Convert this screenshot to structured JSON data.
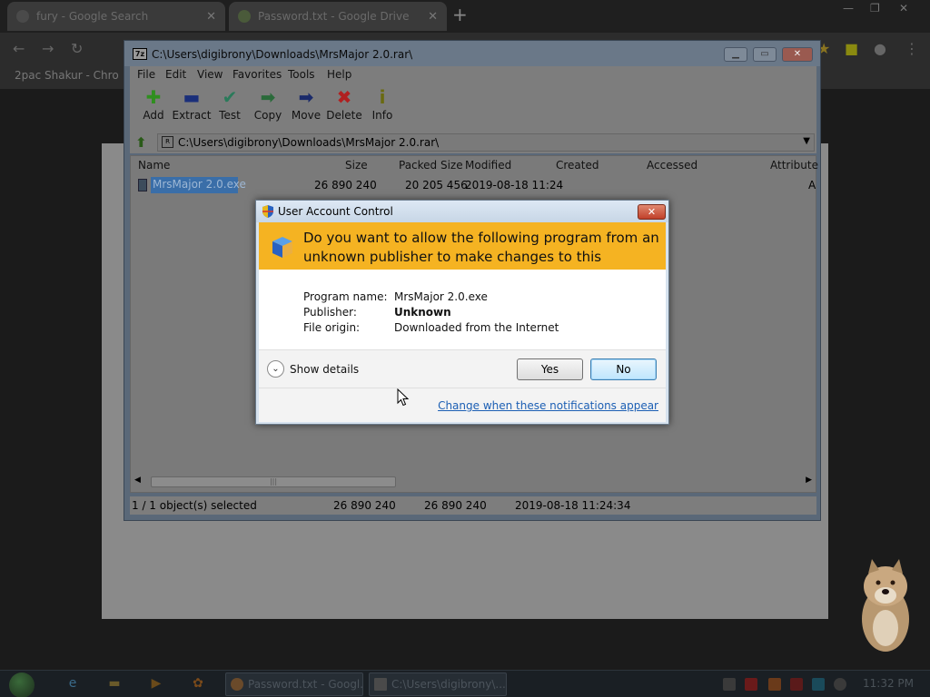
{
  "browser": {
    "tabs": [
      {
        "title": "fury - Google Search"
      },
      {
        "title": "Password.txt - Google Drive"
      }
    ],
    "new_tab": "+",
    "bookmark": "2pac Shakur - Chro"
  },
  "zip_window": {
    "title": "C:\\Users\\digibrony\\Downloads\\MrsMajor 2.0.rar\\",
    "app_icon": "7z",
    "menu": [
      "File",
      "Edit",
      "View",
      "Favorites",
      "Tools",
      "Help"
    ],
    "toolbar": [
      {
        "label": "Add",
        "icon": "plus-icon",
        "glyph": "✚",
        "color": "#2f8f1f"
      },
      {
        "label": "Extract",
        "icon": "minus-icon",
        "glyph": "▬",
        "color": "#1a2f7a"
      },
      {
        "label": "Test",
        "icon": "check-icon",
        "glyph": "✔",
        "color": "#2a7a5a"
      },
      {
        "label": "Copy",
        "icon": "arrow-right-icon",
        "glyph": "➡",
        "color": "#2a6a3a"
      },
      {
        "label": "Move",
        "icon": "arrow-right-icon",
        "glyph": "➡",
        "color": "#1a2a6a"
      },
      {
        "label": "Delete",
        "icon": "delete-icon",
        "glyph": "✖",
        "color": "#b02020"
      },
      {
        "label": "Info",
        "icon": "info-icon",
        "glyph": "i",
        "color": "#6a6a10"
      }
    ],
    "address": "C:\\Users\\digibrony\\Downloads\\MrsMajor 2.0.rar\\",
    "columns": [
      "Name",
      "Size",
      "Packed Size",
      "Modified",
      "Created",
      "Accessed",
      "Attribute"
    ],
    "rows": [
      {
        "name": "MrsMajor 2.0.exe",
        "size": "26 890 240",
        "packed": "20 205 456",
        "modified": "2019-08-18 11:24",
        "created": "",
        "accessed": "",
        "attributes": "A"
      }
    ],
    "status": {
      "selected": "1 / 1 object(s) selected",
      "size": "26 890 240",
      "packed": "26 890 240",
      "modified": "2019-08-18 11:24:34"
    }
  },
  "uac": {
    "title": "User Account Control",
    "close": "✕",
    "question": "Do you want to allow the following program from an unknown publisher to make changes to this computer?",
    "program_name_label": "Program name:",
    "program_name": "MrsMajor 2.0.exe",
    "publisher_label": "Publisher:",
    "publisher": "Unknown",
    "file_origin_label": "File origin:",
    "file_origin": "Downloaded from the Internet",
    "show_details": "Show details",
    "yes": "Yes",
    "no": "No",
    "link": "Change when these notifications appear",
    "banner_color": "#f5b322"
  },
  "taskbar": {
    "tasks": [
      {
        "title": "Password.txt - Googl..."
      },
      {
        "title": "C:\\Users\\digibrony\\..."
      }
    ],
    "clock": "11:32 PM"
  }
}
